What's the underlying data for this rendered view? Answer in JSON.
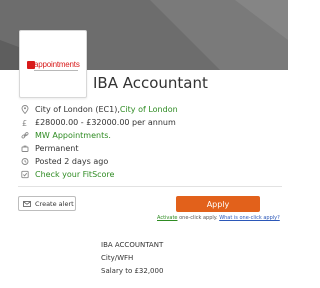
{
  "colors": {
    "banner": "#6b6b6b",
    "accent_green": "#2e8b22",
    "apply_orange": "#e2611b",
    "link_blue": "#2b57b8",
    "logo_red": "#d81b1b"
  },
  "logo": {
    "text": "appointments"
  },
  "job": {
    "title": "IBA Accountant",
    "location_prefix": "City of London (EC1), ",
    "location_link": "City of London",
    "salary": "£28000.00 - £32000.00 per annum",
    "company": "MW Appointments.",
    "contract": "Permanent",
    "posted": "Posted 2 days ago",
    "fitscore": "Check your FitScore"
  },
  "icons": {
    "location": "location-pin-icon",
    "salary": "pound-icon",
    "company": "link-icon",
    "contract": "briefcase-icon",
    "posted": "clock-icon",
    "fitscore": "check-icon",
    "alert": "envelope-icon"
  },
  "actions": {
    "create_alert": "Create alert",
    "apply": "Apply",
    "note_activate": "Activate",
    "note_middle": " one-click apply. ",
    "note_what": "What is one-click apply?"
  },
  "description": {
    "line1": "IBA ACCOUNTANT",
    "line2": "City/WFH",
    "line3": "Salary to £32,000"
  }
}
